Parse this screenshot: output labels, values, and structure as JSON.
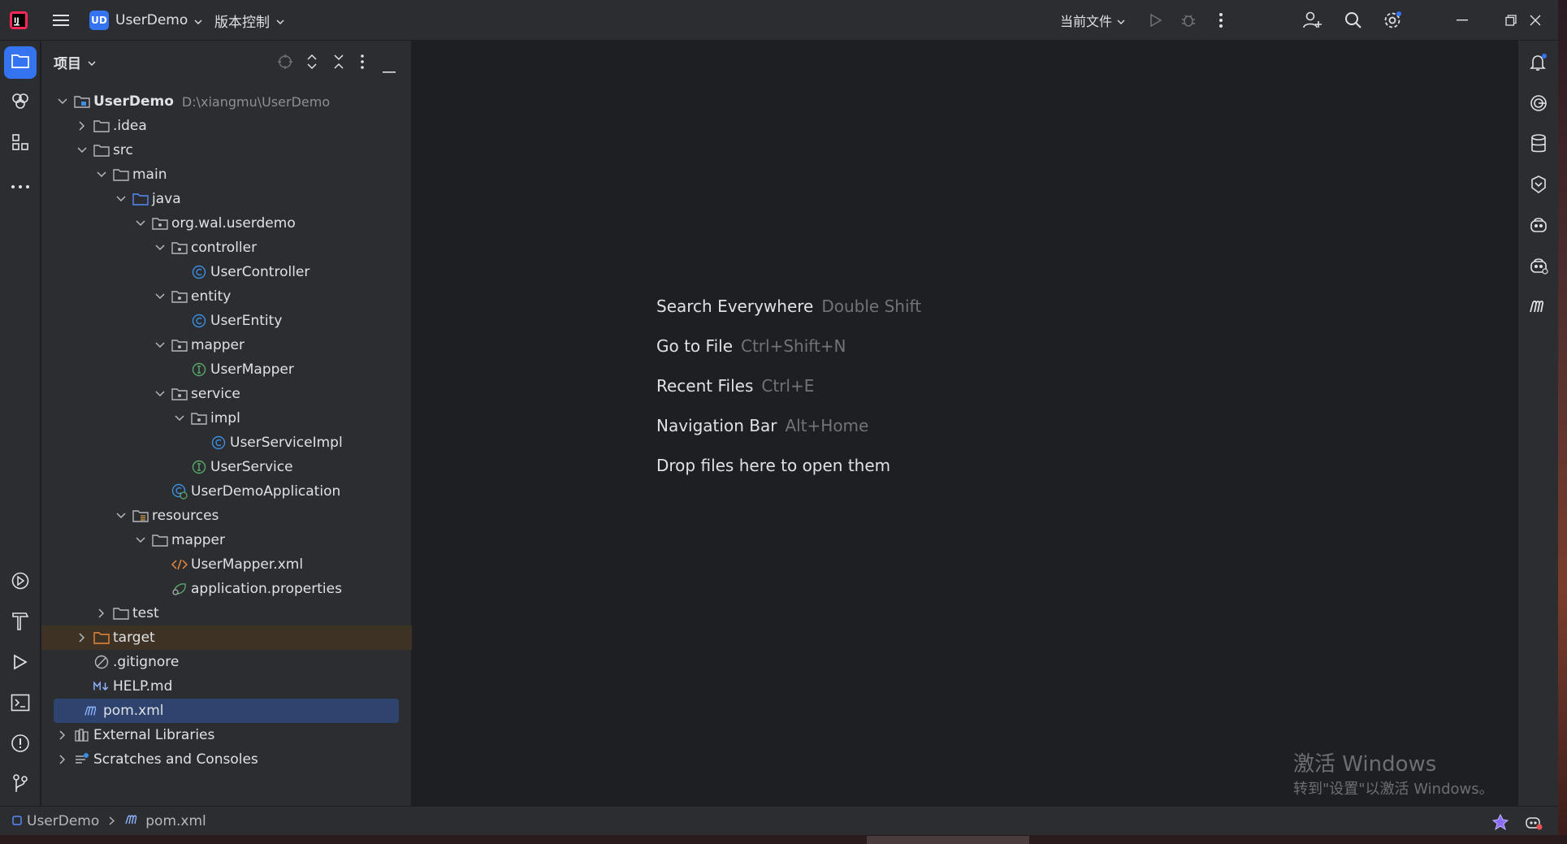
{
  "titlebar": {
    "project_badge": "UD",
    "project_name": "UserDemo",
    "vcs_label": "版本控制",
    "run_config": "当前文件"
  },
  "project_panel": {
    "title": "项目",
    "root_name": "UserDemo",
    "root_path": "D:\\xiangmu\\UserDemo",
    "items": [
      {
        "label": ".idea"
      },
      {
        "label": "src"
      },
      {
        "label": "main"
      },
      {
        "label": "java"
      },
      {
        "label": "org.wal.userdemo"
      },
      {
        "label": "controller"
      },
      {
        "label": "UserController"
      },
      {
        "label": "entity"
      },
      {
        "label": "UserEntity"
      },
      {
        "label": "mapper"
      },
      {
        "label": "UserMapper"
      },
      {
        "label": "service"
      },
      {
        "label": "impl"
      },
      {
        "label": "UserServiceImpl"
      },
      {
        "label": "UserService"
      },
      {
        "label": "UserDemoApplication"
      },
      {
        "label": "resources"
      },
      {
        "label": "mapper"
      },
      {
        "label": "UserMapper.xml"
      },
      {
        "label": "application.properties"
      },
      {
        "label": "test"
      },
      {
        "label": "target"
      },
      {
        "label": ".gitignore"
      },
      {
        "label": "HELP.md"
      },
      {
        "label": "pom.xml"
      },
      {
        "label": "External Libraries"
      },
      {
        "label": "Scratches and Consoles"
      }
    ]
  },
  "editor": {
    "tips": [
      {
        "action": "Search Everywhere",
        "shortcut": "Double Shift"
      },
      {
        "action": "Go to File",
        "shortcut": "Ctrl+Shift+N"
      },
      {
        "action": "Recent Files",
        "shortcut": "Ctrl+E"
      },
      {
        "action": "Navigation Bar",
        "shortcut": "Alt+Home"
      },
      {
        "action": "Drop files here to open them",
        "shortcut": ""
      }
    ],
    "watermark_title": "激活 Windows",
    "watermark_sub": "转到\"设置\"以激活 Windows。"
  },
  "statusbar": {
    "crumb_project": "UserDemo",
    "crumb_file": "pom.xml"
  },
  "colors": {
    "accent": "#3574f0",
    "selection": "#2e436e",
    "excluded_folder_bg": "#3d3223",
    "class_icon": "#3d8fe0",
    "interface_icon": "#59a869"
  }
}
